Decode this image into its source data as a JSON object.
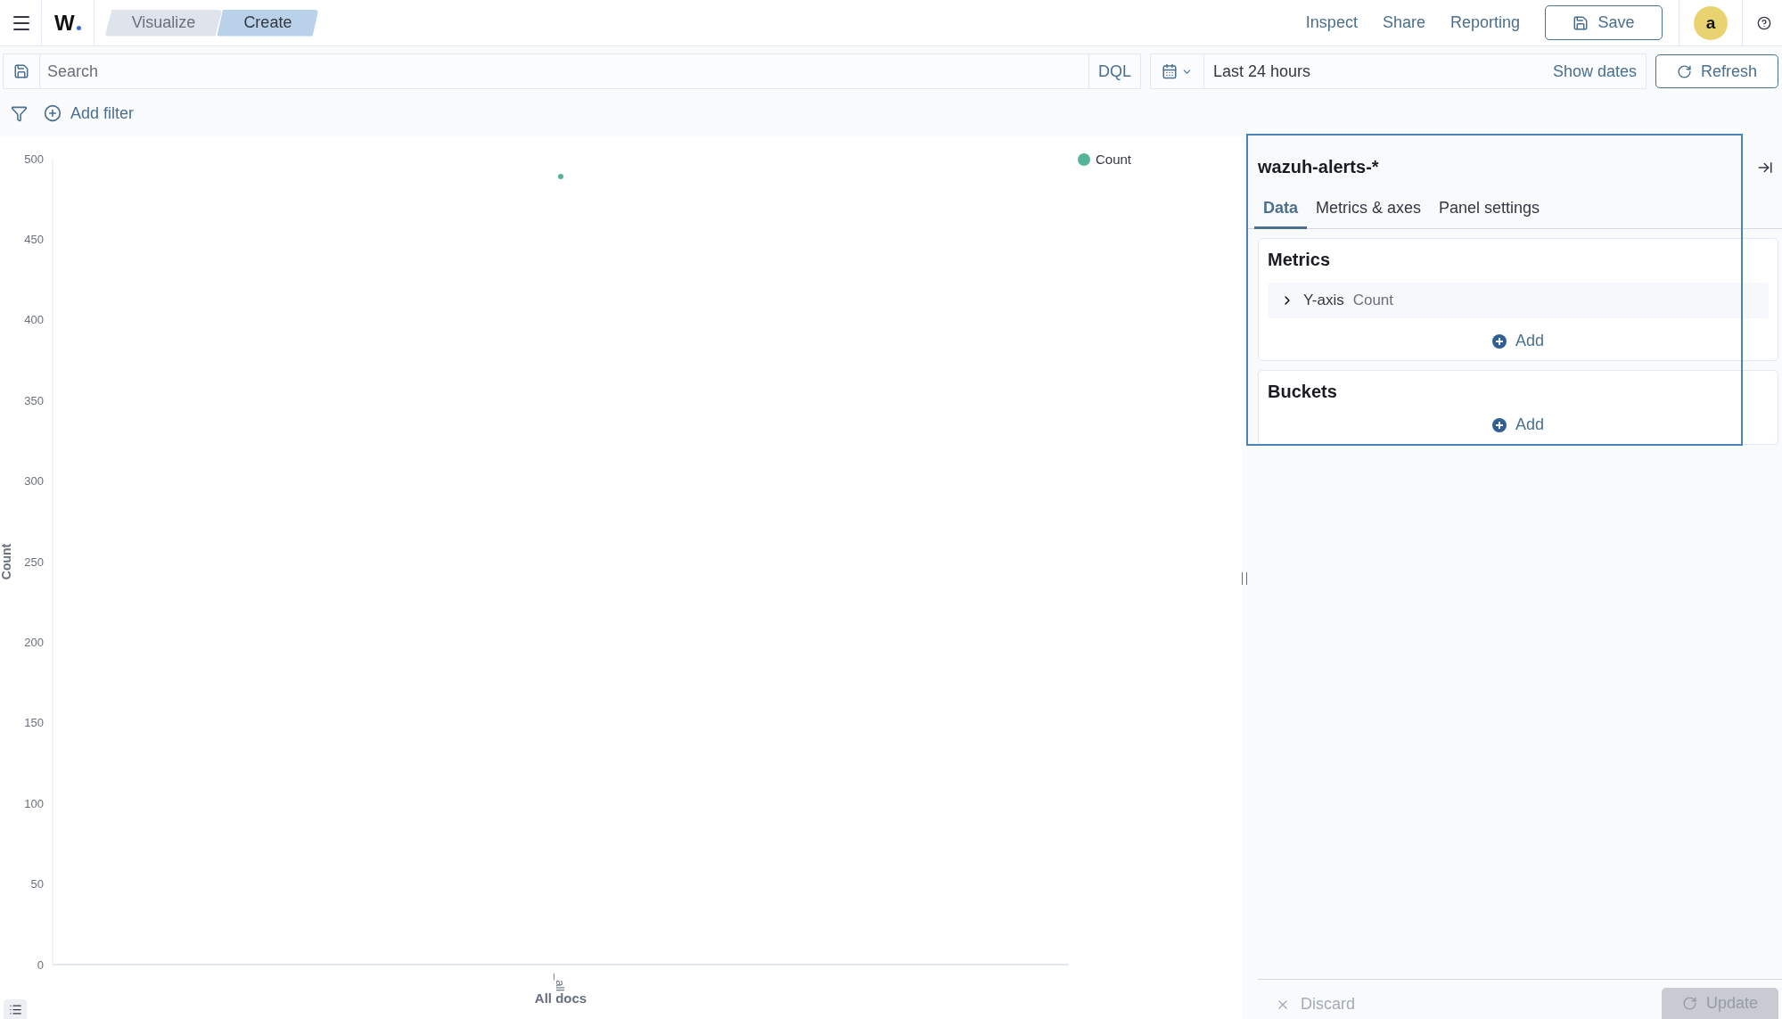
{
  "header": {
    "logo": "W",
    "breadcrumbs": [
      {
        "label": "Visualize",
        "selected": false
      },
      {
        "label": "Create",
        "selected": true
      }
    ],
    "actions": [
      "Inspect",
      "Share",
      "Reporting"
    ],
    "save_button": "Save",
    "avatar": "a"
  },
  "query_bar": {
    "search": {
      "placeholder": "Search"
    },
    "language": "DQL",
    "time_range": "Last 24 hours",
    "show_dates": "Show dates",
    "refresh": "Refresh"
  },
  "filter_bar": {
    "add_filter": "Add filter"
  },
  "chart": {
    "chart_data": {
      "type": "line",
      "xlabel": "All docs",
      "ylabel": "Count",
      "categories": [
        "_all"
      ],
      "series": [
        {
          "name": "Count",
          "color": "#54b399",
          "marker": "circle",
          "values": [
            489
          ]
        }
      ],
      "ylim": [
        0,
        500
      ],
      "yticks": [
        0,
        50,
        100,
        150,
        200,
        250,
        300,
        350,
        400,
        450,
        500
      ]
    }
  },
  "editor": {
    "index_pattern": "wazuh-alerts-*",
    "tabs": [
      {
        "label": "Data",
        "selected": true
      },
      {
        "label": "Metrics & axes",
        "selected": false
      },
      {
        "label": "Panel settings",
        "selected": false
      }
    ],
    "sections": [
      {
        "title": "Metrics",
        "items": [
          {
            "label": "Y-axis",
            "value": "Count",
            "expanded": false
          }
        ],
        "add": "Add"
      },
      {
        "title": "Buckets",
        "add": "Add"
      }
    ],
    "discard": {
      "label": "Discard",
      "disabled": true
    },
    "update": {
      "label": "Update",
      "disabled": true
    }
  }
}
